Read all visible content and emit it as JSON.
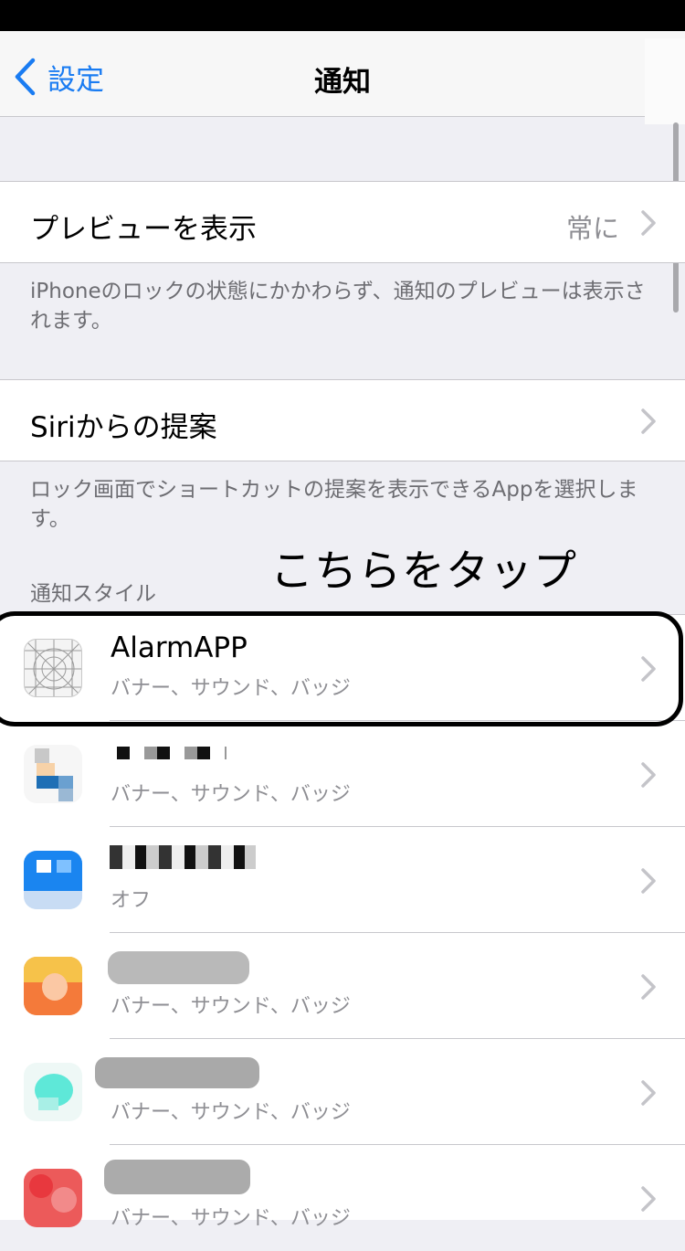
{
  "nav": {
    "back_label": "設定",
    "title": "通知"
  },
  "preview": {
    "label": "プレビューを表示",
    "value": "常に",
    "footnote": "iPhoneのロックの状態にかかわらず、通知のプレビューは表示されます。"
  },
  "siri": {
    "label": "Siriからの提案",
    "footnote": "ロック画面でショートカットの提案を表示できるAppを選択します。"
  },
  "annotation": {
    "text": "こちらをタップ"
  },
  "notification_style": {
    "header": "通知スタイル",
    "apps": [
      {
        "name": "AlarmAPP",
        "detail": "バナー、サウンド、バッジ",
        "icon": "app-placeholder-icon"
      },
      {
        "name": "",
        "detail": "バナー、サウンド、バッジ",
        "icon": "blurred-app-icon"
      },
      {
        "name": "",
        "detail": "オフ",
        "icon": "blurred-app-icon"
      },
      {
        "name": "",
        "detail": "バナー、サウンド、バッジ",
        "icon": "blurred-app-icon"
      },
      {
        "name": "",
        "detail": "バナー、サウンド、バッジ",
        "icon": "blurred-app-icon"
      },
      {
        "name": "",
        "detail": "バナー、サウンド、バッジ",
        "icon": "blurred-app-icon"
      }
    ]
  },
  "colors": {
    "accent": "#1a7cf2",
    "secondary_text": "#8e8e93",
    "grouped_background": "#efeff4"
  }
}
